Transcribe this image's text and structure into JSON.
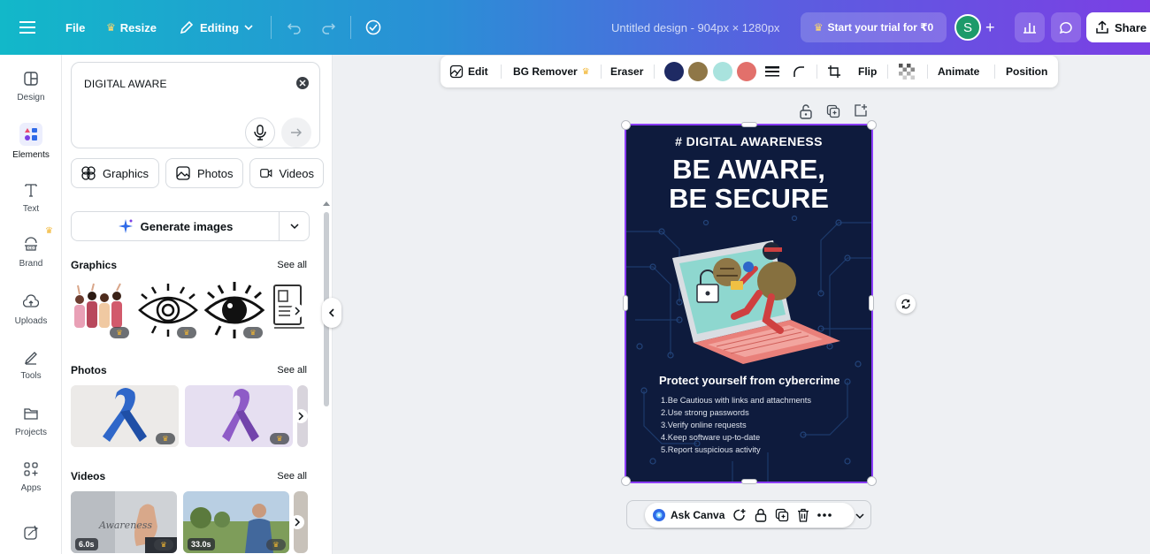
{
  "topbar": {
    "file_label": "File",
    "resize_label": "Resize",
    "editing_label": "Editing",
    "doc_title": "Untitled design - 904px × 1280px",
    "trial_label": "Start your trial for ₹0",
    "avatar_initial": "S",
    "share_label": "Share"
  },
  "rail": {
    "items": [
      {
        "label": "Design",
        "icon": "design-icon"
      },
      {
        "label": "Elements",
        "icon": "elements-icon"
      },
      {
        "label": "Text",
        "icon": "text-icon"
      },
      {
        "label": "Brand",
        "icon": "brand-icon"
      },
      {
        "label": "Uploads",
        "icon": "uploads-icon"
      },
      {
        "label": "Tools",
        "icon": "tools-icon"
      },
      {
        "label": "Projects",
        "icon": "projects-icon"
      },
      {
        "label": "Apps",
        "icon": "apps-icon"
      }
    ]
  },
  "panel": {
    "search_value": "DIGITAL AWARE",
    "chips": [
      "Graphics",
      "Photos",
      "Videos"
    ],
    "generate_label": "Generate images",
    "sections": [
      {
        "title": "Graphics",
        "see_all": "See all"
      },
      {
        "title": "Photos",
        "see_all": "See all"
      },
      {
        "title": "Videos",
        "see_all": "See all"
      }
    ],
    "video_durations": [
      "6.0s",
      "33.0s"
    ],
    "video_caption": "Awareness"
  },
  "context_toolbar": {
    "edit_label": "Edit",
    "bg_remover_label": "BG Remover",
    "eraser_label": "Eraser",
    "swatches": [
      "#1e2a63",
      "#8f7747",
      "#a9e3de",
      "#e2706b"
    ],
    "flip_label": "Flip",
    "animate_label": "Animate",
    "position_label": "Position"
  },
  "design": {
    "tag": "# DIGITAL AWARENESS",
    "headline_1": "BE AWARE,",
    "headline_2": "BE SECURE",
    "subheading": "Protect yourself from cybercrime",
    "tips": [
      "1.Be Cautious with links and attachments",
      "2.Use strong passwords",
      "3.Verify online requests",
      "4.Keep software up-to-date",
      "5.Report suspicious activity"
    ]
  },
  "bottom_bar": {
    "ask_label": "Ask Canva"
  },
  "colors": {
    "brand_gradient_start": "#12b8c9",
    "brand_gradient_end": "#7b3fe4",
    "selection": "#8b3dff",
    "poster_bg": "#0e1b3d",
    "crown": "#f2b632"
  }
}
